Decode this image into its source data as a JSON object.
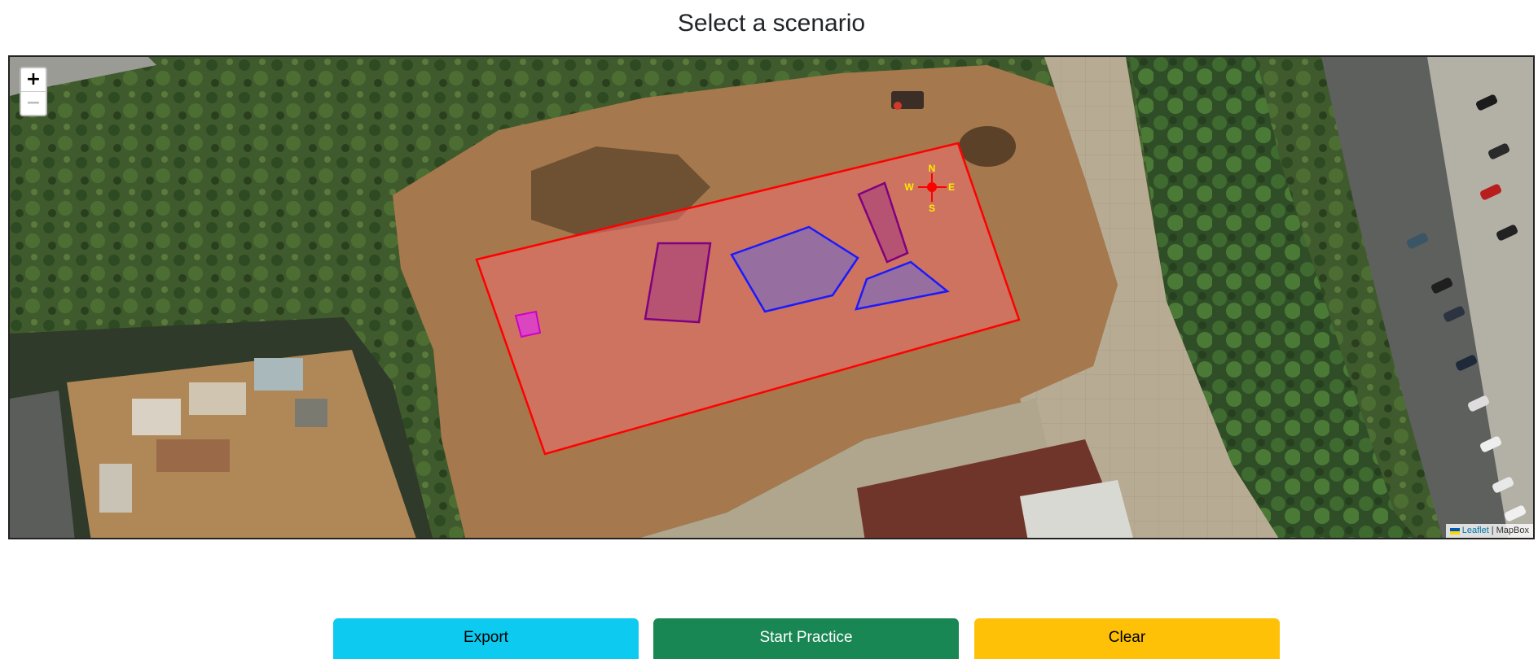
{
  "page": {
    "title": "Select a scenario"
  },
  "map": {
    "zoom_in_label": "+",
    "zoom_out_label": "−",
    "attribution_link": "Leaflet",
    "attribution_separator": "|",
    "attribution_provider": "MapBox",
    "compass": {
      "north": "N",
      "south": "S",
      "east": "E",
      "west": "W"
    },
    "colors": {
      "field_outline": "#ff0000",
      "field_fill": "#f07070",
      "blue_zone": "#1a1aff",
      "purple_zone": "#800080",
      "magenta_marker": "#cc00cc",
      "compass": "#ff0000"
    },
    "icons": [
      "plus-icon",
      "minus-icon",
      "ukraine-flag-icon",
      "compass-rose-icon"
    ]
  },
  "actions": {
    "export_label": "Export",
    "start_label": "Start Practice",
    "clear_label": "Clear"
  }
}
